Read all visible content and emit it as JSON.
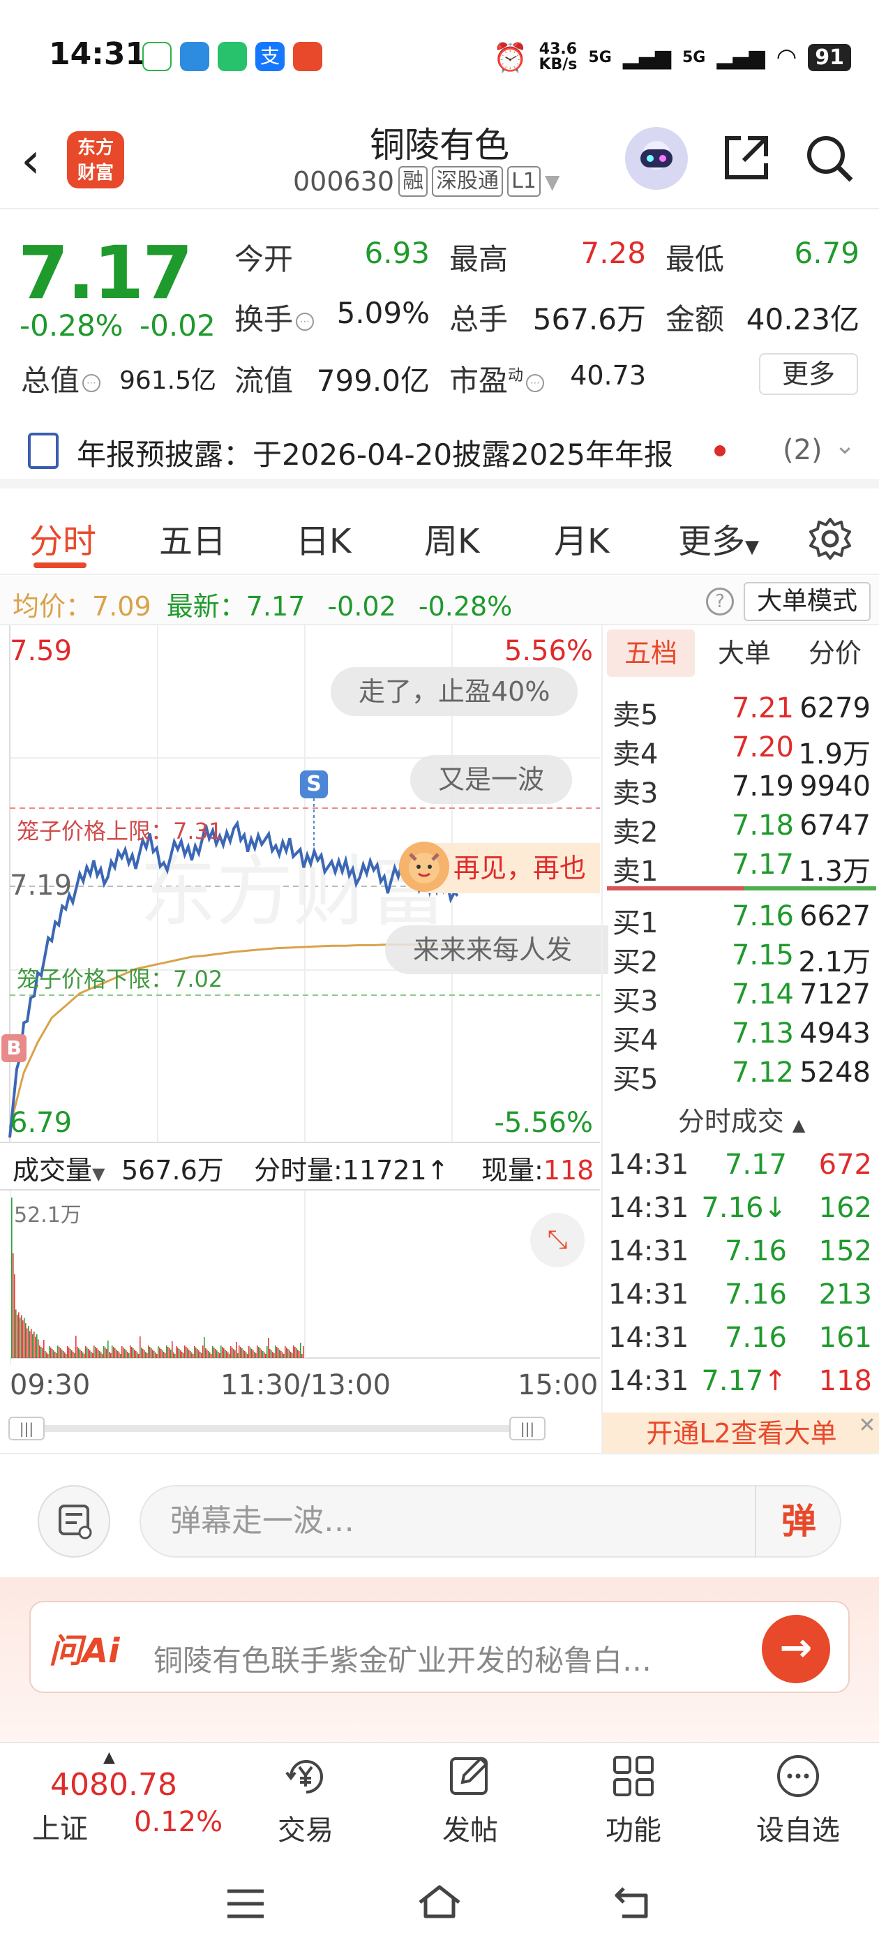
{
  "status_bar": {
    "time": "14:31",
    "net_speed_value": "43.6",
    "net_speed_unit": "KB/s",
    "sig1": "5G",
    "sig2": "5G",
    "battery": "91"
  },
  "header": {
    "logo_line1": "东方",
    "logo_line2": "财富",
    "stock_name": "铜陵有色",
    "stock_code": "000630",
    "tags": [
      "融",
      "深股通",
      "L1"
    ]
  },
  "quote": {
    "price": "7.17",
    "pct": "-0.28%",
    "chg": "-0.02",
    "open_label": "今开",
    "open": "6.93",
    "high_label": "最高",
    "high": "7.28",
    "low_label": "最低",
    "low": "6.79",
    "turnover_label": "换手",
    "turnover": "5.09%",
    "volume_label": "总手",
    "volume": "567.6万",
    "amount_label": "金额",
    "amount": "40.23亿",
    "mktcap_label": "总值",
    "mktcap": "961.5亿",
    "float_label": "流值",
    "float": "799.0亿",
    "pe_label": "市盈",
    "pe_sup": "动",
    "pe": "40.73",
    "more": "更多"
  },
  "announcement": {
    "text": "年报预披露：于2026-04-20披露2025年年报",
    "count": "(2)"
  },
  "tabs": [
    "分时",
    "五日",
    "日K",
    "周K",
    "月K",
    "更多"
  ],
  "chart_info": {
    "avg_label": "均价：",
    "avg": "7.09",
    "last_label": "最新：",
    "last": "7.17",
    "chg": "-0.02",
    "pct": "-0.28%",
    "mode_btn": "大单模式"
  },
  "chart": {
    "y_top": "7.59",
    "y_top_pct": "5.56%",
    "y_mid": "7.19",
    "y_bottom": "6.79",
    "y_bottom_pct": "-5.56%",
    "cage_upper": "笼子价格上限：7.31",
    "cage_lower": "笼子价格下限：7.02",
    "s_marker": "S",
    "b_marker": "B",
    "danmaku": [
      "走了，止盈40%",
      "又是一波",
      "再见，再也",
      "来来来每人发"
    ],
    "vol_label": "成交量",
    "vol_total": "567.6万",
    "tick_vol": "分时量:11721↑",
    "now_vol_label": "现量:",
    "now_vol": "118",
    "vol_max": "52.1万",
    "time_axis": [
      "09:30",
      "11:30/13:00",
      "15:00"
    ]
  },
  "chart_data": {
    "type": "line",
    "title": "",
    "xlabel": "",
    "ylabel": "",
    "ylim": [
      6.79,
      7.59
    ],
    "x_range": [
      "09:30",
      "15:00"
    ],
    "series": [
      {
        "name": "",
        "color": "#3b67b5",
        "values": [
          6.79,
          6.95,
          7.04,
          7.1,
          7.16,
          7.19,
          7.22,
          7.2,
          7.24,
          7.23,
          7.26,
          7.22,
          7.25,
          7.24,
          7.27,
          7.26,
          7.28,
          7.25,
          7.27,
          7.24,
          7.26,
          7.22,
          7.24,
          7.21,
          7.22,
          7.2,
          7.22,
          7.19,
          7.21,
          7.2,
          7.18,
          7.19,
          7.17
        ]
      },
      {
        "name": "",
        "color": "#d9a24a",
        "values": [
          6.79,
          6.88,
          6.93,
          6.97,
          6.99,
          7.01,
          7.02,
          7.03,
          7.04,
          7.05,
          7.055,
          7.06,
          7.065,
          7.07,
          7.072,
          7.075,
          7.078,
          7.08,
          7.082,
          7.084,
          7.085,
          7.086,
          7.087,
          7.088,
          7.088,
          7.089,
          7.089,
          7.09,
          7.09,
          7.09,
          7.09,
          7.09,
          7.09
        ]
      }
    ]
  },
  "order_book": {
    "tabs": [
      "五档",
      "大单",
      "分价"
    ],
    "asks": [
      {
        "label": "卖5",
        "price": "7.21",
        "vol": "6279",
        "color": "#e02b2b"
      },
      {
        "label": "卖4",
        "price": "7.20",
        "vol": "1.9万",
        "color": "#e02b2b"
      },
      {
        "label": "卖3",
        "price": "7.19",
        "vol": "9940",
        "color": "#222222"
      },
      {
        "label": "卖2",
        "price": "7.18",
        "vol": "6747",
        "color": "#1f9a2c"
      },
      {
        "label": "卖1",
        "price": "7.17",
        "vol": "1.3万",
        "color": "#1f9a2c"
      }
    ],
    "bids": [
      {
        "label": "买1",
        "price": "7.16",
        "vol": "6627",
        "color": "#1f9a2c"
      },
      {
        "label": "买2",
        "price": "7.15",
        "vol": "2.1万",
        "color": "#1f9a2c"
      },
      {
        "label": "买3",
        "price": "7.14",
        "vol": "7127",
        "color": "#1f9a2c"
      },
      {
        "label": "买4",
        "price": "7.13",
        "vol": "4943",
        "color": "#1f9a2c"
      },
      {
        "label": "买5",
        "price": "7.12",
        "vol": "5248",
        "color": "#1f9a2c"
      }
    ],
    "trades_title": "分时成交",
    "trades": [
      {
        "time": "14:31",
        "price": "7.17",
        "vol": "672",
        "vcolor": "#e02b2b",
        "arrow": ""
      },
      {
        "time": "14:31",
        "price": "7.16",
        "vol": "162",
        "vcolor": "#1f9a2c",
        "arrow": "↓"
      },
      {
        "time": "14:31",
        "price": "7.16",
        "vol": "152",
        "vcolor": "#1f9a2c",
        "arrow": ""
      },
      {
        "time": "14:31",
        "price": "7.16",
        "vol": "213",
        "vcolor": "#1f9a2c",
        "arrow": ""
      },
      {
        "time": "14:31",
        "price": "7.16",
        "vol": "161",
        "vcolor": "#1f9a2c",
        "arrow": ""
      },
      {
        "time": "14:31",
        "price": "7.17",
        "vol": "118",
        "vcolor": "#e02b2b",
        "arrow": "↑"
      }
    ],
    "l2": "开通L2查看大单"
  },
  "comment": {
    "placeholder": "弹幕走一波…",
    "danmu_btn": "弹"
  },
  "ai": {
    "logo": "问Ai",
    "text": "铜陵有色联手紫金矿业开发的秘鲁白…"
  },
  "bottom_nav": {
    "index_value": "4080.78",
    "index_name": "上证",
    "index_pct": "0.12%",
    "items": [
      "交易",
      "发帖",
      "功能",
      "设自选"
    ]
  }
}
